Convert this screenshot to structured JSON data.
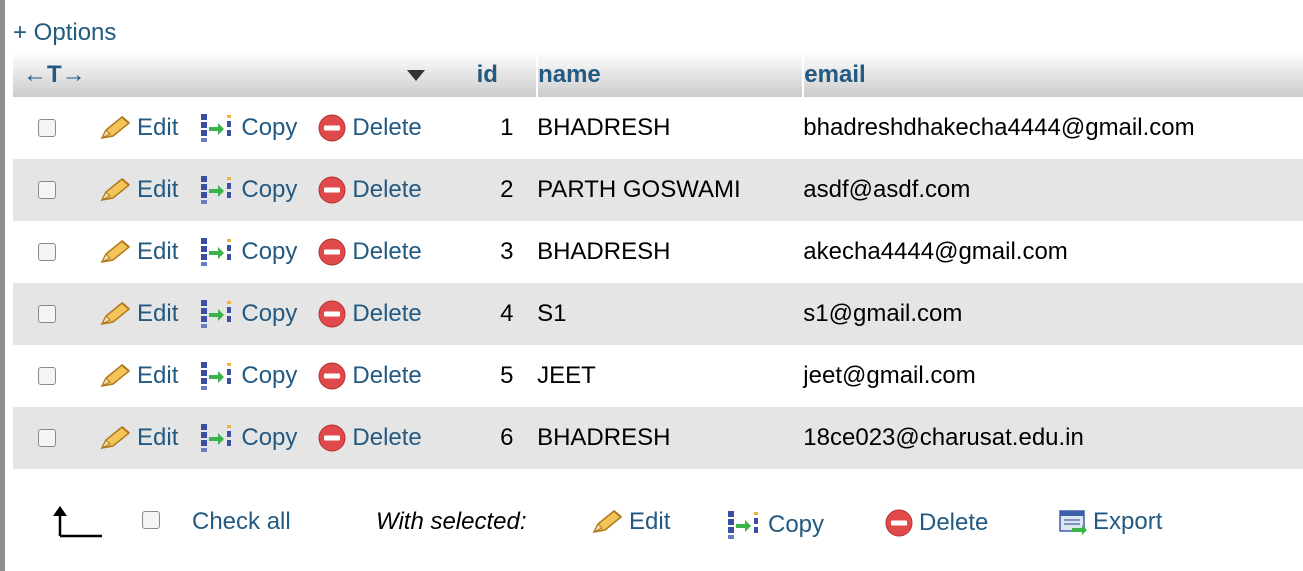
{
  "options_link": "+ Options",
  "header": {
    "nav_arrows": "←T→",
    "columns": [
      "id",
      "name",
      "email"
    ]
  },
  "row_actions": {
    "edit": "Edit",
    "copy": "Copy",
    "delete": "Delete"
  },
  "rows": [
    {
      "id": "1",
      "name": "BHADRESH",
      "email": "bhadreshdhakecha4444@gmail.com"
    },
    {
      "id": "2",
      "name": "PARTH GOSWAMI",
      "email": "asdf@asdf.com"
    },
    {
      "id": "3",
      "name": "BHADRESH",
      "email": "akecha4444@gmail.com"
    },
    {
      "id": "4",
      "name": "S1",
      "email": "s1@gmail.com"
    },
    {
      "id": "5",
      "name": "JEET",
      "email": "jeet@gmail.com"
    },
    {
      "id": "6",
      "name": "BHADRESH",
      "email": "18ce023@charusat.edu.in"
    }
  ],
  "footer": {
    "check_all": "Check all",
    "with_selected": "With selected:",
    "edit": "Edit",
    "copy": "Copy",
    "delete": "Delete",
    "export": "Export"
  },
  "colors": {
    "link": "#235a81",
    "row_alt": "#e5e5e5",
    "delete_red": "#e04a4a",
    "pencil_yellow": "#f0b43c"
  }
}
